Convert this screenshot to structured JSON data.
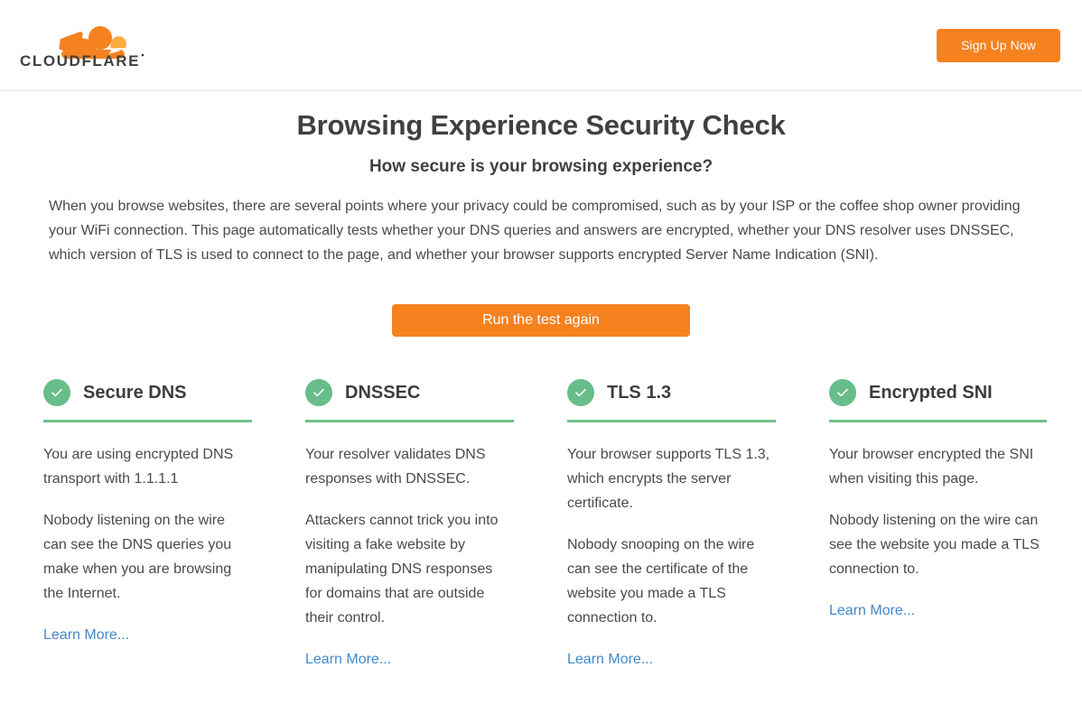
{
  "header": {
    "logo_text": "CLOUDFLARE",
    "logo_icon": "cloudflare-cloud-icon",
    "signup_label": "Sign Up Now",
    "brand_orange": "#f6821f",
    "brand_amber": "#fbad41"
  },
  "titles": {
    "main": "Browsing Experience Security Check",
    "sub": "How secure is your browsing experience?"
  },
  "intro": "When you browse websites, there are several points where your privacy could be compromised, such as by your ISP or the coffee shop owner providing your WiFi connection. This page automatically tests whether your DNS queries and answers are encrypted, whether your DNS resolver uses DNSSEC, which version of TLS is used to connect to the page, and whether your browser supports encrypted Server Name Indication (SNI).",
  "actions": {
    "run_test_label": "Run the test again"
  },
  "status_colors": {
    "pass_circle": "#68bd8b",
    "rule": "#6fc18e",
    "link": "#4288cc"
  },
  "results": [
    {
      "id": "secure-dns",
      "title": "Secure DNS",
      "status": "pass",
      "status_icon": "check-circle-icon",
      "paragraph_1": "You are using encrypted DNS transport with 1.1.1.1",
      "paragraph_2": "Nobody listening on the wire can see the DNS queries you make when you are browsing the Internet.",
      "learn_more": "Learn More..."
    },
    {
      "id": "dnssec",
      "title": "DNSSEC",
      "status": "pass",
      "status_icon": "check-circle-icon",
      "paragraph_1": "Your resolver validates DNS responses with DNSSEC.",
      "paragraph_2": "Attackers cannot trick you into visiting a fake website by manipulating DNS responses for domains that are outside their control.",
      "learn_more": "Learn More..."
    },
    {
      "id": "tls-13",
      "title": "TLS 1.3",
      "status": "pass",
      "status_icon": "check-circle-icon",
      "paragraph_1": "Your browser supports TLS 1.3, which encrypts the server certificate.",
      "paragraph_2": "Nobody snooping on the wire can see the certificate of the website you made a TLS connection to.",
      "learn_more": "Learn More..."
    },
    {
      "id": "encrypted-sni",
      "title": "Encrypted SNI",
      "status": "pass",
      "status_icon": "check-circle-icon",
      "paragraph_1": "Your browser encrypted the SNI when visiting this page.",
      "paragraph_2": "Nobody listening on the wire can see the website you made a TLS connection to.",
      "learn_more": "Learn More..."
    }
  ]
}
